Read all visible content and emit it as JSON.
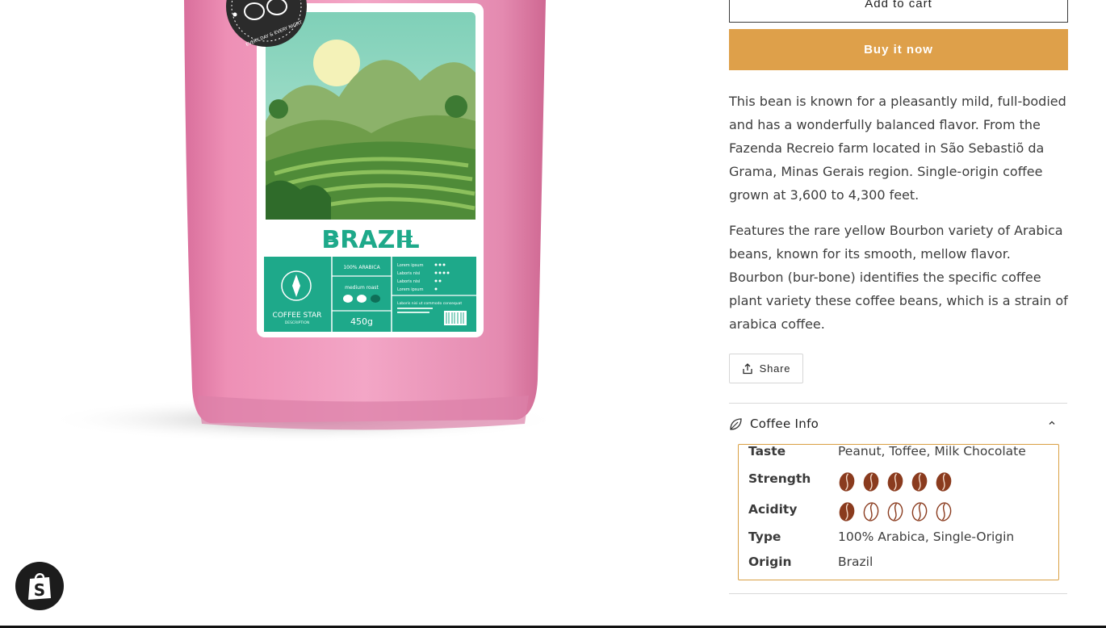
{
  "actions": {
    "add_to_cart": "Add to cart",
    "buy_now": "Buy it now"
  },
  "description": {
    "paragraphs": [
      "This bean is known for a pleasantly mild, full-bodied and has a wonderfully balanced flavor. From the Fazenda Recreio farm located in São Sebastiõ da Grama, Minas Gerais region. Single-origin coffee grown at 3,600 to 4,300 feet.",
      "Features the rare yellow Bourbon variety of Arabica beans, known for its smooth, mellow flavor. Bourbon (bur-bone) identifies the specific coffee plant variety these coffee beans, which is a strain of arabica coffee."
    ]
  },
  "share": {
    "label": "Share",
    "icon": "share-icon"
  },
  "coffee_info": {
    "title": "Coffee Info",
    "icon": "leaf-icon",
    "expanded": true,
    "rows": {
      "taste": {
        "label": "Taste",
        "value": "Peanut, Toffee, Milk Chocolate"
      },
      "strength": {
        "label": "Strength",
        "rating": 5,
        "max": 5
      },
      "acidity": {
        "label": "Acidity",
        "rating": 1,
        "max": 5
      },
      "type": {
        "label": "Type",
        "value": "100% Arabica, Single-Origin"
      },
      "origin": {
        "label": "Origin",
        "value": "Brazil"
      }
    }
  },
  "product_image": {
    "brand_text": "COFFEE STAR",
    "brand_sub": "DESCRIPTION",
    "name": "BRAZIL",
    "badge_text": "EVERY DAY & EVERY NIGHT",
    "label_lines": [
      "100% ARABICA",
      "medium roast",
      "450g"
    ],
    "lorem_lines": [
      "Lorem ipsum",
      "Laboris nisi",
      "Laboris nisi",
      "Lorem ipsum"
    ],
    "lorem_note": "Laboris nisi ut commodo consequat"
  },
  "colors": {
    "buy_button": "#dea04a",
    "accent_border": "#d9a043",
    "bean_fill": "#8a3b1e",
    "bag_pink": "#e889b0",
    "label_teal": "#1ea98a"
  },
  "shopify_badge": {
    "icon": "shopify-bag-icon"
  }
}
